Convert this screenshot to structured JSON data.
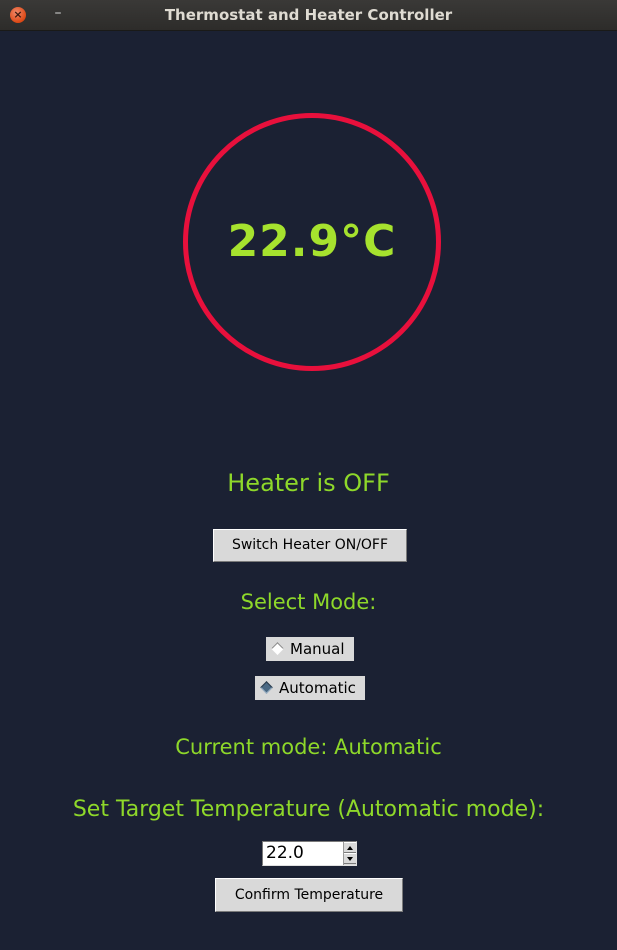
{
  "window": {
    "title": "Thermostat and Heater Controller",
    "close_icon": "close-icon",
    "minimize_icon": "minimize-icon",
    "minimize_glyph": "–"
  },
  "gauge": {
    "temperature": "22.9°C",
    "ring_color": "#e8103c",
    "text_color": "#a6e22e"
  },
  "heater": {
    "status": "Heater is OFF",
    "toggle_label": "Switch Heater ON/OFF"
  },
  "mode": {
    "heading": "Select Mode:",
    "options": [
      {
        "label": "Manual",
        "selected": false
      },
      {
        "label": "Automatic",
        "selected": true
      }
    ],
    "current": "Current mode: Automatic"
  },
  "target": {
    "label": "Set Target Temperature (Automatic mode):",
    "value": "22.0",
    "confirm_label": "Confirm Temperature"
  },
  "colors": {
    "background": "#1b2133",
    "label_green": "#8ed82a"
  }
}
